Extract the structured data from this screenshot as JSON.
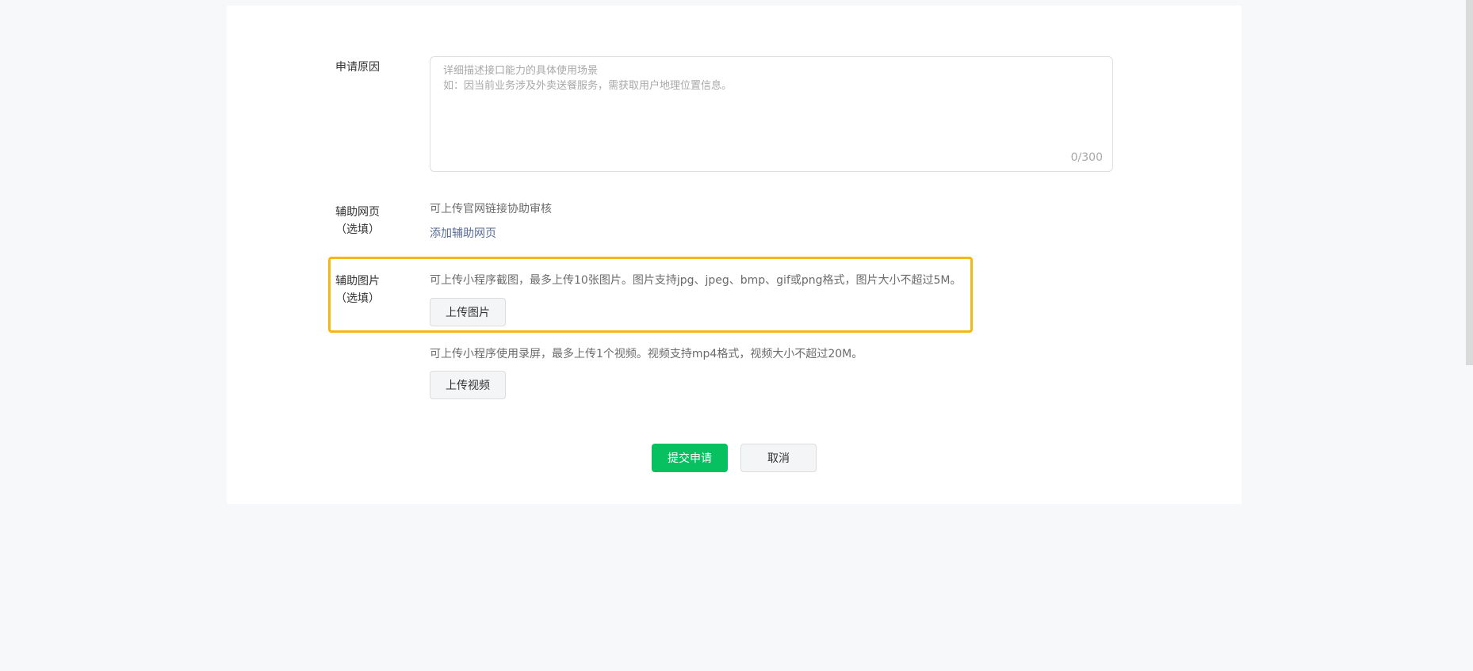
{
  "form": {
    "reason": {
      "label": "申请原因",
      "placeholder_line1": "详细描述接口能力的具体使用场景",
      "placeholder_line2": "如：因当前业务涉及外卖送餐服务，需获取用户地理位置信息。",
      "counter": "0/300"
    },
    "webpage": {
      "label": "辅助网页",
      "optional": "（选填）",
      "hint": "可上传官网链接协助审核",
      "add_link": "添加辅助网页"
    },
    "image": {
      "label": "辅助图片",
      "optional": "（选填）",
      "hint": "可上传小程序截图，最多上传10张图片。图片支持jpg、jpeg、bmp、gif或png格式，图片大小不超过5M。",
      "upload_button": "上传图片"
    },
    "video": {
      "hint": "可上传小程序使用录屏，最多上传1个视频。视频支持mp4格式，视频大小不超过20M。",
      "upload_button": "上传视频"
    }
  },
  "actions": {
    "submit": "提交申请",
    "cancel": "取消"
  },
  "colors": {
    "primary": "#07c160",
    "link": "#576b95",
    "highlight": "#f3b814"
  }
}
